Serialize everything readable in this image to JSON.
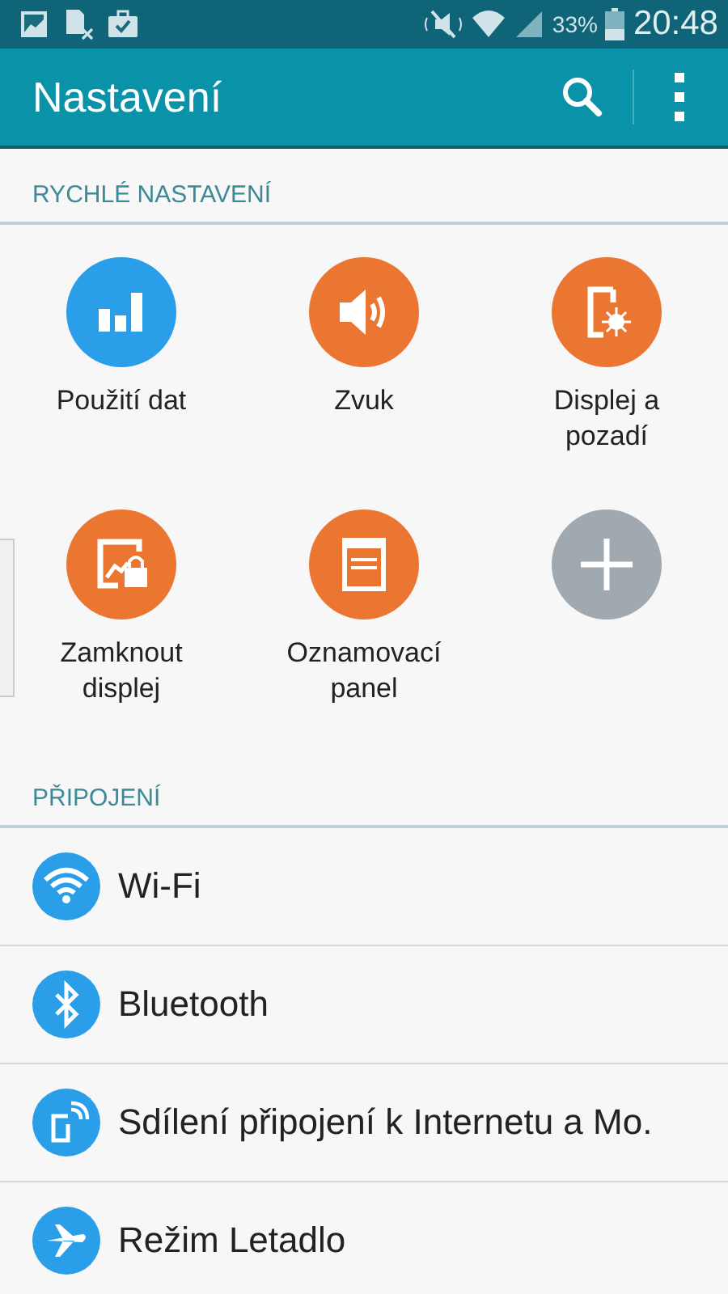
{
  "status_bar": {
    "battery": "33%",
    "time": "20:48"
  },
  "app_bar": {
    "title": "Nastavení"
  },
  "quick_settings": {
    "header": "RYCHLÉ NASTAVENÍ",
    "tiles": [
      {
        "kind": "data",
        "label": "Použití dat",
        "color": "#2a9ee8"
      },
      {
        "kind": "sound",
        "label": "Zvuk",
        "color": "#eb7631"
      },
      {
        "kind": "display",
        "label": "Displej a pozadí",
        "color": "#eb7631"
      },
      {
        "kind": "lock",
        "label": "Zamknout displej",
        "color": "#eb7631"
      },
      {
        "kind": "panel",
        "label": "Oznamovací panel",
        "color": "#eb7631"
      },
      {
        "kind": "add",
        "color": "#a0a8b0"
      }
    ]
  },
  "connections": {
    "header": "PŘIPOJENÍ",
    "items": [
      {
        "kind": "wifi",
        "label": "Wi-Fi"
      },
      {
        "kind": "bluetooth",
        "label": "Bluetooth"
      },
      {
        "kind": "tethering",
        "label": "Sdílení připojení k Internetu a Mo."
      },
      {
        "kind": "airplane",
        "label": "Režim Letadlo"
      }
    ]
  }
}
